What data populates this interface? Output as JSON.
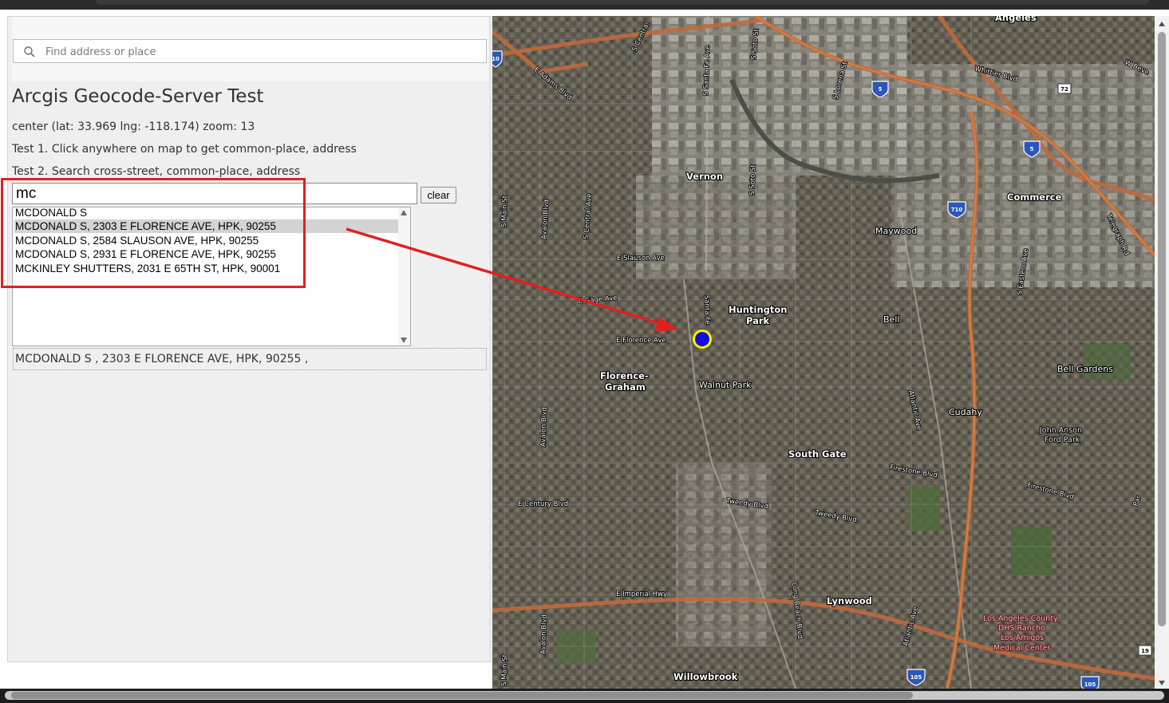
{
  "search": {
    "placeholder": "Find address or place"
  },
  "page": {
    "title": "Arcgis Geocode-Server Test",
    "center_info": "center (lat: 33.969 lng: -118.174) zoom: 13",
    "test1": "Test 1. Click anywhere on map to get common-place, address",
    "test2": "Test 2. Search cross-street, common-place, address"
  },
  "query": {
    "value": "mc",
    "clear_label": "clear"
  },
  "suggestions": {
    "items": [
      "MCDONALD S",
      "MCDONALD S, 2303 E FLORENCE AVE, HPK, 90255",
      "MCDONALD S, 2584 SLAUSON AVE, HPK, 90255",
      "MCDONALD S, 2931 E FLORENCE AVE, HPK, 90255",
      "MCKINLEY SHUTTERS, 2031 E 65TH ST, HPK, 90001"
    ],
    "selected_index": 1
  },
  "result": {
    "text": "MCDONALD S , 2303 E FLORENCE AVE, HPK, 90255 ,"
  },
  "map": {
    "places": {
      "angeles": "Angeles",
      "vernon": "Vernon",
      "commerce": "Commerce",
      "maywood": "Maywood",
      "huntington": "Huntington",
      "park": "Park",
      "bell": "Bell",
      "florence": "Florence-",
      "graham": "Graham",
      "walnut_park": "Walnut Park",
      "bell_gardens": "Bell Gardens",
      "cudahy": "Cudahy",
      "john_anson": "John Anson",
      "ford_park": "Ford Park",
      "south_gate": "South Gate",
      "lynwood": "Lynwood",
      "willowbrook": "Willowbrook",
      "la_county": "Los Angeles County",
      "dhs_rancho": "DHS Rancho",
      "los_amigos": "Los Amigos",
      "medical_center": "Medical Center"
    },
    "streets": {
      "s_central": "S Central",
      "e_adams": "E Adams Blvd",
      "santa_fe_ave": "S Santa Fe Ave",
      "s_soto": "S Soto St",
      "s_lorena": "S Lorena St",
      "whittier": "Whittier Blvd",
      "w_beverly": "W Beve",
      "s_soto_2": "S Soto St",
      "s_main": "S Main St",
      "avalon_1": "Avalon Blvd",
      "s_central_ave": "S Central Ave",
      "slauson": "E Slauson Ave",
      "gage": "E Gage Ave",
      "florence_ave": "E Florence Ave",
      "santa_fe_short": "Santa Fe",
      "telegraph": "Telegraph Rd",
      "s_eastern": "S Eastern Ave",
      "atlantic_1": "Atlantic Ave",
      "firestone_1": "Firestone Blvd",
      "firestone_2": "Firestone Blvd",
      "avalon_2": "Avalon Blvd",
      "century": "E Century Blvd",
      "tweedy_1": "Tweedy Blvd",
      "tweedy_2": "Tweedy Blvd",
      "imperial": "E Imperial Hwy",
      "long_beach": "Long Beach Blvd",
      "atlantic_2": "Atlantic Ave",
      "avalon_3": "Avalon Blvd",
      "s_main_2": "S Main St",
      "paramount": "Par"
    },
    "shields": {
      "i5_a": "5",
      "i5_b": "5",
      "i710": "710",
      "r72": "72",
      "i105_a": "105",
      "i105_b": "105",
      "r19": "19",
      "i10": "10"
    },
    "colors": {
      "marker_fill": "#1010e0",
      "marker_ring": "#ffee00",
      "arrow": "#e02020",
      "freeway": "#c06a3c"
    }
  }
}
